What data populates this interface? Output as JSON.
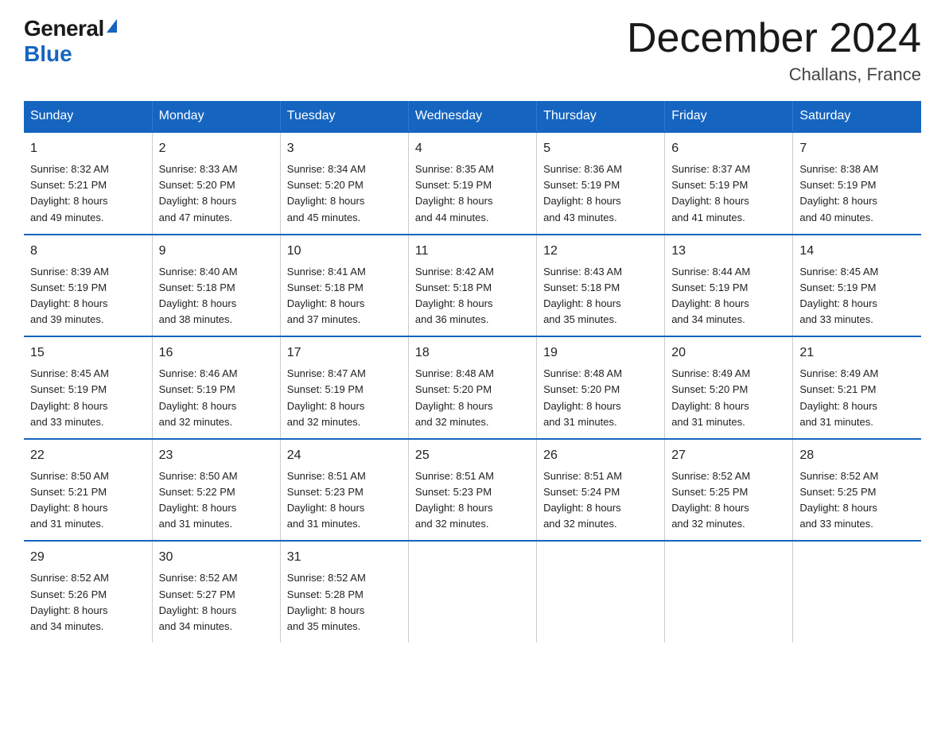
{
  "header": {
    "logo_general": "General",
    "logo_blue": "Blue",
    "month_title": "December 2024",
    "location": "Challans, France"
  },
  "weekdays": [
    "Sunday",
    "Monday",
    "Tuesday",
    "Wednesday",
    "Thursday",
    "Friday",
    "Saturday"
  ],
  "weeks": [
    [
      {
        "day": "1",
        "sunrise": "8:32 AM",
        "sunset": "5:21 PM",
        "daylight": "8 hours and 49 minutes."
      },
      {
        "day": "2",
        "sunrise": "8:33 AM",
        "sunset": "5:20 PM",
        "daylight": "8 hours and 47 minutes."
      },
      {
        "day": "3",
        "sunrise": "8:34 AM",
        "sunset": "5:20 PM",
        "daylight": "8 hours and 45 minutes."
      },
      {
        "day": "4",
        "sunrise": "8:35 AM",
        "sunset": "5:19 PM",
        "daylight": "8 hours and 44 minutes."
      },
      {
        "day": "5",
        "sunrise": "8:36 AM",
        "sunset": "5:19 PM",
        "daylight": "8 hours and 43 minutes."
      },
      {
        "day": "6",
        "sunrise": "8:37 AM",
        "sunset": "5:19 PM",
        "daylight": "8 hours and 41 minutes."
      },
      {
        "day": "7",
        "sunrise": "8:38 AM",
        "sunset": "5:19 PM",
        "daylight": "8 hours and 40 minutes."
      }
    ],
    [
      {
        "day": "8",
        "sunrise": "8:39 AM",
        "sunset": "5:19 PM",
        "daylight": "8 hours and 39 minutes."
      },
      {
        "day": "9",
        "sunrise": "8:40 AM",
        "sunset": "5:18 PM",
        "daylight": "8 hours and 38 minutes."
      },
      {
        "day": "10",
        "sunrise": "8:41 AM",
        "sunset": "5:18 PM",
        "daylight": "8 hours and 37 minutes."
      },
      {
        "day": "11",
        "sunrise": "8:42 AM",
        "sunset": "5:18 PM",
        "daylight": "8 hours and 36 minutes."
      },
      {
        "day": "12",
        "sunrise": "8:43 AM",
        "sunset": "5:18 PM",
        "daylight": "8 hours and 35 minutes."
      },
      {
        "day": "13",
        "sunrise": "8:44 AM",
        "sunset": "5:19 PM",
        "daylight": "8 hours and 34 minutes."
      },
      {
        "day": "14",
        "sunrise": "8:45 AM",
        "sunset": "5:19 PM",
        "daylight": "8 hours and 33 minutes."
      }
    ],
    [
      {
        "day": "15",
        "sunrise": "8:45 AM",
        "sunset": "5:19 PM",
        "daylight": "8 hours and 33 minutes."
      },
      {
        "day": "16",
        "sunrise": "8:46 AM",
        "sunset": "5:19 PM",
        "daylight": "8 hours and 32 minutes."
      },
      {
        "day": "17",
        "sunrise": "8:47 AM",
        "sunset": "5:19 PM",
        "daylight": "8 hours and 32 minutes."
      },
      {
        "day": "18",
        "sunrise": "8:48 AM",
        "sunset": "5:20 PM",
        "daylight": "8 hours and 32 minutes."
      },
      {
        "day": "19",
        "sunrise": "8:48 AM",
        "sunset": "5:20 PM",
        "daylight": "8 hours and 31 minutes."
      },
      {
        "day": "20",
        "sunrise": "8:49 AM",
        "sunset": "5:20 PM",
        "daylight": "8 hours and 31 minutes."
      },
      {
        "day": "21",
        "sunrise": "8:49 AM",
        "sunset": "5:21 PM",
        "daylight": "8 hours and 31 minutes."
      }
    ],
    [
      {
        "day": "22",
        "sunrise": "8:50 AM",
        "sunset": "5:21 PM",
        "daylight": "8 hours and 31 minutes."
      },
      {
        "day": "23",
        "sunrise": "8:50 AM",
        "sunset": "5:22 PM",
        "daylight": "8 hours and 31 minutes."
      },
      {
        "day": "24",
        "sunrise": "8:51 AM",
        "sunset": "5:23 PM",
        "daylight": "8 hours and 31 minutes."
      },
      {
        "day": "25",
        "sunrise": "8:51 AM",
        "sunset": "5:23 PM",
        "daylight": "8 hours and 32 minutes."
      },
      {
        "day": "26",
        "sunrise": "8:51 AM",
        "sunset": "5:24 PM",
        "daylight": "8 hours and 32 minutes."
      },
      {
        "day": "27",
        "sunrise": "8:52 AM",
        "sunset": "5:25 PM",
        "daylight": "8 hours and 32 minutes."
      },
      {
        "day": "28",
        "sunrise": "8:52 AM",
        "sunset": "5:25 PM",
        "daylight": "8 hours and 33 minutes."
      }
    ],
    [
      {
        "day": "29",
        "sunrise": "8:52 AM",
        "sunset": "5:26 PM",
        "daylight": "8 hours and 34 minutes."
      },
      {
        "day": "30",
        "sunrise": "8:52 AM",
        "sunset": "5:27 PM",
        "daylight": "8 hours and 34 minutes."
      },
      {
        "day": "31",
        "sunrise": "8:52 AM",
        "sunset": "5:28 PM",
        "daylight": "8 hours and 35 minutes."
      },
      null,
      null,
      null,
      null
    ]
  ],
  "labels": {
    "sunrise": "Sunrise:",
    "sunset": "Sunset:",
    "daylight": "Daylight:"
  }
}
